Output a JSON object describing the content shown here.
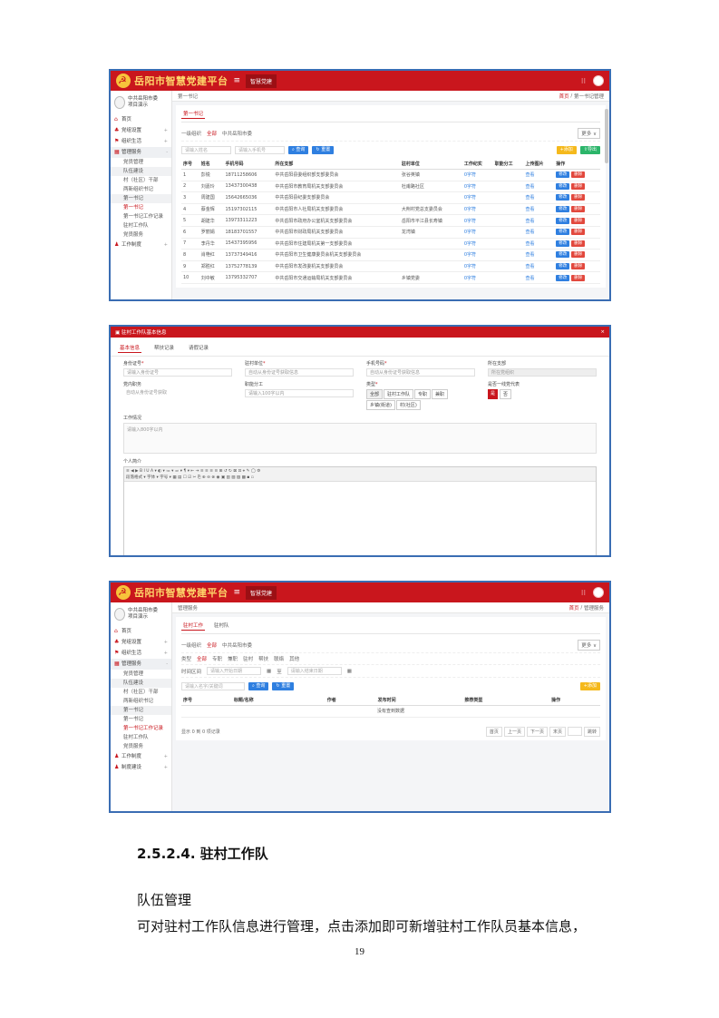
{
  "app": {
    "logo_text": "岳阳市智慧党建平台",
    "menu_icon": "≡",
    "workspace_btn": "智慧党建"
  },
  "sidebar": {
    "user_name": "中共岳阳市委",
    "user_role": "项目演示",
    "items": [
      {
        "icon": "home-icon",
        "label": "首页"
      },
      {
        "icon": "org-icon",
        "label": "党组设置"
      },
      {
        "icon": "flag-icon",
        "label": "组织生活"
      },
      {
        "icon": "manage-icon",
        "label": "管理服务"
      }
    ],
    "subs_1": [
      "党员管理",
      "队伍建设",
      "村（社区）干部",
      "两新组织书记",
      "驻村工作队"
    ],
    "subs_1_b": [
      "第一书记",
      "第一书记工作记录",
      "驻村工作队"
    ],
    "subs_1_c": [
      "党员服务"
    ],
    "bottom_1": "工作制度",
    "subs_3_b": [
      "驻村工作队",
      "党员服务"
    ],
    "bottom_3": [
      "工作制度",
      "制度建设"
    ]
  },
  "ss1": {
    "crumb_left": "第一书记",
    "crumb_home": "首页",
    "crumb_right": "第一书记管理",
    "tab": "第一书记",
    "filter_label": "一级组织",
    "filter_all": "全部",
    "filter_value": "中共岳阳市委",
    "more": "更多",
    "search_placeholder": "请输入姓名",
    "phone_placeholder": "请输入手机号",
    "search_btn": "查询",
    "reset_btn": "重置",
    "add_btn": "添加",
    "export_btn": "导出",
    "columns": [
      "序号",
      "姓名",
      "手机号码",
      "所在支部",
      "驻村单位",
      "工作纪实",
      "职能分工",
      "上传图片",
      "操作"
    ],
    "rows": [
      [
        "1",
        "彭锐",
        "18711258606",
        "中共岳阳县委组织部支部委员会",
        "张谷英镇",
        "0字符",
        "",
        "查看"
      ],
      [
        "2",
        "刘嘉玲",
        "13437300438",
        "中共岳阳市教育局机关支部委员会",
        "杜甫路社区",
        "0字符",
        "",
        "查看"
      ],
      [
        "3",
        "周建国",
        "15642665036",
        "中共岳阳县纪委支部委员会",
        "",
        "0字符",
        "",
        "查看"
      ],
      [
        "4",
        "蔡金辉",
        "15197302115",
        "中共岳阳市人社局机关支部委员会",
        "大荆村党总支委员会",
        "0字符",
        "",
        "查看"
      ],
      [
        "5",
        "胡建华",
        "13973311223",
        "中共岳阳市政府办公室机关支部委员会",
        "岳阳市平江县长寿镇",
        "0字符",
        "",
        "查看"
      ],
      [
        "6",
        "罗丽娟",
        "18183701557",
        "中共岳阳市财政局机关支部委员会",
        "龙湾镇",
        "0字符",
        "",
        "查看"
      ],
      [
        "7",
        "李丹华",
        "15437395956",
        "中共岳阳市住建局机关第一支部委员会",
        "",
        "0字符",
        "",
        "查看"
      ],
      [
        "8",
        "肖艳红",
        "13737349416",
        "中共岳阳市卫生健康委员会机关支部委员会",
        "",
        "0字符",
        "",
        "查看"
      ],
      [
        "9",
        "郑胜红",
        "13752778139",
        "中共岳阳市发改委机关支部委员会",
        "",
        "0字符",
        "",
        "查看"
      ],
      [
        "10",
        "刘中敏",
        "13795332707",
        "中共岳阳市交通运输局机关支部委员会",
        "乡镇党委",
        "0字符",
        "",
        "查看"
      ]
    ],
    "edit_btn": "修改",
    "del_btn": "删除"
  },
  "ss2": {
    "title": "驻村工作队基本信息",
    "close": "×",
    "tabs": [
      "基本信息",
      "帮扶记录",
      "请假记录"
    ],
    "f_id": "身份证号",
    "f_id_ph": "请输入身份证号",
    "f_org": "驻村单位",
    "f_org_ph": "自动从身份证号获取信息",
    "f_phone": "手机号码",
    "f_phone_ph": "自动从身份证号获取信息",
    "f_branch": "所在支部",
    "f_branch_ph": "所在党组织",
    "f_post": "党内职务",
    "f_post_ph": "自动从身份证号获取",
    "f_duty": "职能分工",
    "f_duty_ph": "请输入100字以内",
    "f_type": "类型",
    "type_chips": [
      "全部",
      "驻村工作队",
      "专职",
      "兼职",
      "乡镇(街道)",
      "村(社区)"
    ],
    "f_leader": "是否一线党代表",
    "yes": "是",
    "no": "否",
    "f_work": "工作情况",
    "f_work_ph": "请输入800字以内",
    "f_intro": "个人简介",
    "editor_row1": "≡ ◀ ▶ B I U A ▾ ◐ ▾ ≔ ▾ ≕ ▾ ¶ ▾ ⇤ ⇥ ≡ ≡ ≡ ≡ ⊞ ↺ ↻ ⊠ ⊡ ⌖ ✎ ◯ ⚙",
    "editor_row2": "段落格式 ▾ 字体 ▾ 字号 ▾ ▦ ▤ ☐ ☑ ✂ ⎘ ⊕ ⊖ ⊗ ◉ ▣ ▥ ▧ ▨ ▩ ▪ ▫"
  },
  "ss3": {
    "crumb_left": "管理服务",
    "crumb_home": "首页",
    "crumb_right": "管理服务",
    "tabs": [
      "驻村工作",
      "驻村队"
    ],
    "filter_label": "一级组织",
    "filter_all": "全部",
    "filter_value": "中共岳阳市委",
    "filter2_label": "类型",
    "filter2_items": [
      "全部",
      "专职",
      "兼职",
      "驻村",
      "帮扶",
      "联络",
      "其他"
    ],
    "filter3_label": "时间区间",
    "date_start": "请输入开始日期",
    "date_to": "至",
    "date_end": "请输入结束日期",
    "more": "更多",
    "search_placeholder": "请输入名字/关键词",
    "search_btn": "查询",
    "reset_btn": "重置",
    "add_btn": "添加",
    "columns": [
      "序号",
      "标题/名称",
      "作者",
      "发布时间",
      "推荐类型",
      "操作"
    ],
    "empty": "没有查到数据",
    "total": "显示 0 到 0 项记录",
    "pager": [
      "首页",
      "上一页",
      "下一页",
      "末页",
      "跳转"
    ]
  },
  "doc": {
    "heading": "2.5.2.4.  驻村工作队",
    "p1": "队伍管理",
    "p2": "可对驻村工作队信息进行管理，点击添加即可新增驻村工作队员基本信息，",
    "page_number": "19"
  }
}
